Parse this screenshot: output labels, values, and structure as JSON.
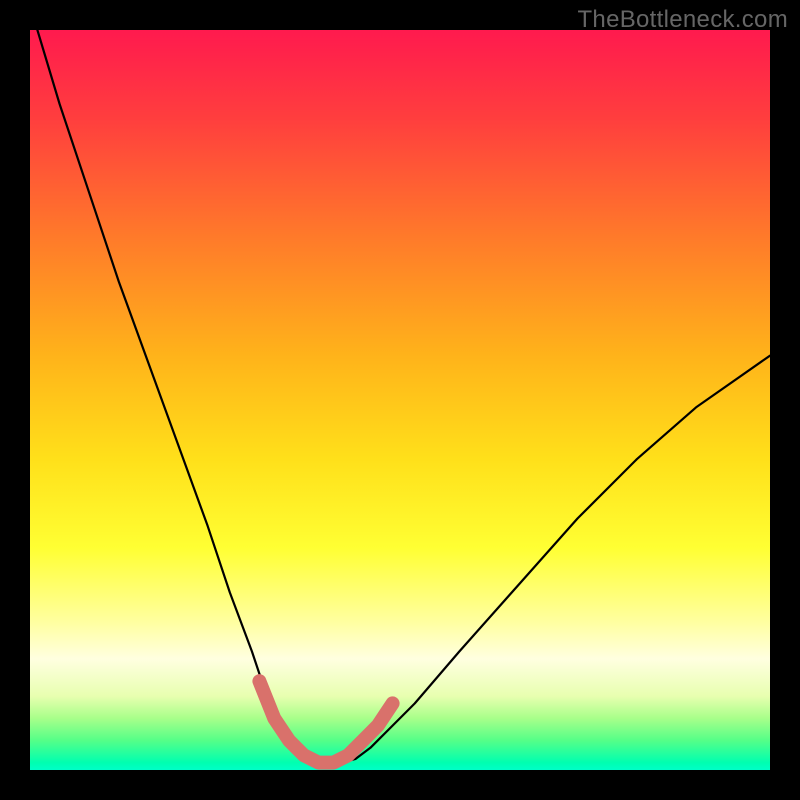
{
  "watermark": {
    "text": "TheBottleneck.com"
  },
  "chart_data": {
    "type": "line",
    "title": "",
    "xlabel": "",
    "ylabel": "",
    "xlim": [
      0,
      100
    ],
    "ylim": [
      0,
      100
    ],
    "legend_position": "none",
    "grid": false,
    "series": [
      {
        "name": "bottleneck-curve",
        "x": [
          1,
          4,
          8,
          12,
          16,
          20,
          24,
          27,
          30,
          32,
          34,
          36,
          38,
          40,
          42,
          44,
          46,
          48,
          52,
          58,
          66,
          74,
          82,
          90,
          100
        ],
        "y": [
          100,
          90,
          78,
          66,
          55,
          44,
          33,
          24,
          16,
          10,
          6,
          3,
          1.5,
          1,
          1,
          1.5,
          3,
          5,
          9,
          16,
          25,
          34,
          42,
          49,
          56
        ],
        "annotation": "Thin black V-shaped curve; minimum ~0 at x≈38-44; left branch rises to y=100 at x≈1; right branch rises to y≈56 at x=100."
      },
      {
        "name": "optimal-zone-marker",
        "x": [
          31,
          33,
          35,
          37,
          39,
          41,
          43,
          45,
          47,
          49
        ],
        "y": [
          12,
          7,
          4,
          2,
          1,
          1,
          2,
          4,
          6,
          9
        ],
        "annotation": "Thick salmon segment tracing the bottom of the V (near-zero bottleneck region)."
      }
    ],
    "background_gradient": {
      "orientation": "vertical",
      "stops": [
        {
          "pos": 0,
          "color": "#ff1a4e"
        },
        {
          "pos": 28,
          "color": "#ff7a2a"
        },
        {
          "pos": 58,
          "color": "#ffe01a"
        },
        {
          "pos": 85,
          "color": "#ffffe0"
        },
        {
          "pos": 100,
          "color": "#00ffc8"
        }
      ]
    },
    "colors": {
      "curve_main": "#000000",
      "curve_marker": "#d9716b",
      "frame": "#000000"
    }
  }
}
